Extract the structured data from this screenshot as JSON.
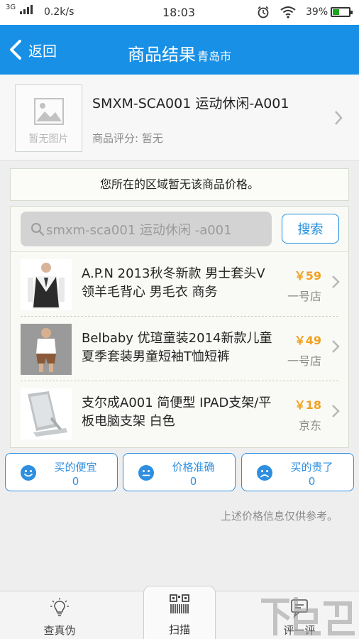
{
  "status_bar": {
    "network": "3G",
    "speed": "0.2k/s",
    "time": "18:03",
    "battery": "39%",
    "battery_level": 0.39,
    "icons": [
      "signal-icon",
      "alarm-icon",
      "wifi-icon",
      "battery-icon"
    ]
  },
  "nav": {
    "back_label": "返回",
    "title": "商品结果",
    "city": "青岛市"
  },
  "product": {
    "name": "SMXM-SCA001 运动休闲-A001",
    "no_image": "暂无图片",
    "rating": "商品评分: 暂无"
  },
  "notice": "您所在的区域暂无该商品价格。",
  "search": {
    "value": "smxm-sca001 运动休闲 -a001",
    "button": "搜索"
  },
  "results": [
    {
      "title": "A.P.N 2013秋冬新款 男士套头V领羊毛背心 男毛衣 商务",
      "price": "￥59",
      "store": "一号店",
      "thumb": "vest-photo"
    },
    {
      "title": "Belbaby 优瑄童装2014新款儿童夏季套装男童短袖T恤短裤",
      "price": "￥49",
      "store": "一号店",
      "thumb": "kids-outfit-photo"
    },
    {
      "title": "支尔成A001 简便型 IPAD支架/平板电脑支架 白色",
      "price": "￥18",
      "store": "京东",
      "thumb": "tablet-stand-photo"
    }
  ],
  "feedback": [
    {
      "label": "买的便宜",
      "count": "0",
      "icon": "smile-icon"
    },
    {
      "label": "价格准确",
      "count": "0",
      "icon": "neutral-face-icon"
    },
    {
      "label": "买的贵了",
      "count": "0",
      "icon": "sad-face-icon"
    }
  ],
  "disclaimer": "上述价格信息仅供参考。",
  "tabs": [
    {
      "label": "查真伪",
      "icon": "lightbulb-icon"
    },
    {
      "label": "扫描",
      "icon": "barcode-scan-icon",
      "active": true
    },
    {
      "label": "评一评",
      "icon": "review-icon"
    }
  ],
  "colors": {
    "brand": "#1890e6",
    "price": "#f0a020",
    "accent": "#2e8fe0"
  }
}
